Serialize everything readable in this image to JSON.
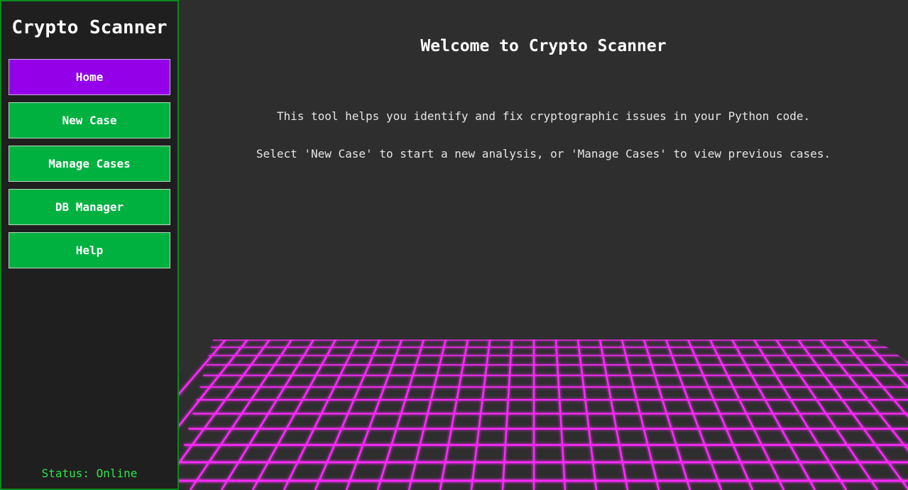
{
  "sidebar": {
    "title": "Crypto Scanner",
    "items": [
      {
        "label": "Home",
        "active": true
      },
      {
        "label": "New Case",
        "active": false
      },
      {
        "label": "Manage Cases",
        "active": false
      },
      {
        "label": "DB Manager",
        "active": false
      },
      {
        "label": "Help",
        "active": false
      }
    ],
    "status": "Status: Online"
  },
  "main": {
    "heading": "Welcome to Crypto Scanner",
    "line1": "This tool helps you identify and fix cryptographic issues in your Python code.",
    "line2": "Select 'New Case' to start a new analysis, or 'Manage Cases' to view previous cases."
  },
  "colors": {
    "nav_button": "#00b140",
    "nav_active": "#9400e8",
    "status_text": "#2ee54a",
    "grid_line": "#ff2bff",
    "sidebar_border": "#0a8a1c"
  }
}
